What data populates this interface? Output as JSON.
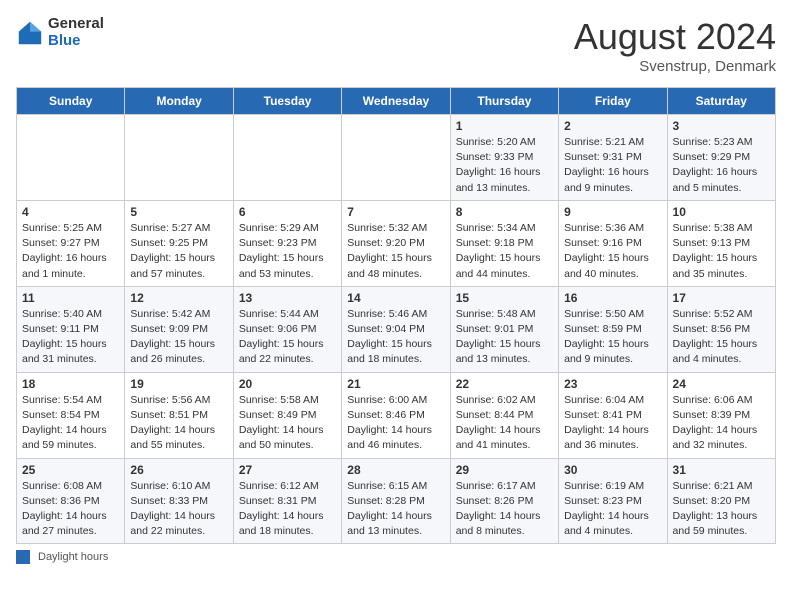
{
  "header": {
    "logo_general": "General",
    "logo_blue": "Blue",
    "title": "August 2024",
    "location": "Svenstrup, Denmark"
  },
  "days_of_week": [
    "Sunday",
    "Monday",
    "Tuesday",
    "Wednesday",
    "Thursday",
    "Friday",
    "Saturday"
  ],
  "weeks": [
    [
      {
        "day": "",
        "detail": ""
      },
      {
        "day": "",
        "detail": ""
      },
      {
        "day": "",
        "detail": ""
      },
      {
        "day": "",
        "detail": ""
      },
      {
        "day": "1",
        "detail": "Sunrise: 5:20 AM\nSunset: 9:33 PM\nDaylight: 16 hours\nand 13 minutes."
      },
      {
        "day": "2",
        "detail": "Sunrise: 5:21 AM\nSunset: 9:31 PM\nDaylight: 16 hours\nand 9 minutes."
      },
      {
        "day": "3",
        "detail": "Sunrise: 5:23 AM\nSunset: 9:29 PM\nDaylight: 16 hours\nand 5 minutes."
      }
    ],
    [
      {
        "day": "4",
        "detail": "Sunrise: 5:25 AM\nSunset: 9:27 PM\nDaylight: 16 hours\nand 1 minute."
      },
      {
        "day": "5",
        "detail": "Sunrise: 5:27 AM\nSunset: 9:25 PM\nDaylight: 15 hours\nand 57 minutes."
      },
      {
        "day": "6",
        "detail": "Sunrise: 5:29 AM\nSunset: 9:23 PM\nDaylight: 15 hours\nand 53 minutes."
      },
      {
        "day": "7",
        "detail": "Sunrise: 5:32 AM\nSunset: 9:20 PM\nDaylight: 15 hours\nand 48 minutes."
      },
      {
        "day": "8",
        "detail": "Sunrise: 5:34 AM\nSunset: 9:18 PM\nDaylight: 15 hours\nand 44 minutes."
      },
      {
        "day": "9",
        "detail": "Sunrise: 5:36 AM\nSunset: 9:16 PM\nDaylight: 15 hours\nand 40 minutes."
      },
      {
        "day": "10",
        "detail": "Sunrise: 5:38 AM\nSunset: 9:13 PM\nDaylight: 15 hours\nand 35 minutes."
      }
    ],
    [
      {
        "day": "11",
        "detail": "Sunrise: 5:40 AM\nSunset: 9:11 PM\nDaylight: 15 hours\nand 31 minutes."
      },
      {
        "day": "12",
        "detail": "Sunrise: 5:42 AM\nSunset: 9:09 PM\nDaylight: 15 hours\nand 26 minutes."
      },
      {
        "day": "13",
        "detail": "Sunrise: 5:44 AM\nSunset: 9:06 PM\nDaylight: 15 hours\nand 22 minutes."
      },
      {
        "day": "14",
        "detail": "Sunrise: 5:46 AM\nSunset: 9:04 PM\nDaylight: 15 hours\nand 18 minutes."
      },
      {
        "day": "15",
        "detail": "Sunrise: 5:48 AM\nSunset: 9:01 PM\nDaylight: 15 hours\nand 13 minutes."
      },
      {
        "day": "16",
        "detail": "Sunrise: 5:50 AM\nSunset: 8:59 PM\nDaylight: 15 hours\nand 9 minutes."
      },
      {
        "day": "17",
        "detail": "Sunrise: 5:52 AM\nSunset: 8:56 PM\nDaylight: 15 hours\nand 4 minutes."
      }
    ],
    [
      {
        "day": "18",
        "detail": "Sunrise: 5:54 AM\nSunset: 8:54 PM\nDaylight: 14 hours\nand 59 minutes."
      },
      {
        "day": "19",
        "detail": "Sunrise: 5:56 AM\nSunset: 8:51 PM\nDaylight: 14 hours\nand 55 minutes."
      },
      {
        "day": "20",
        "detail": "Sunrise: 5:58 AM\nSunset: 8:49 PM\nDaylight: 14 hours\nand 50 minutes."
      },
      {
        "day": "21",
        "detail": "Sunrise: 6:00 AM\nSunset: 8:46 PM\nDaylight: 14 hours\nand 46 minutes."
      },
      {
        "day": "22",
        "detail": "Sunrise: 6:02 AM\nSunset: 8:44 PM\nDaylight: 14 hours\nand 41 minutes."
      },
      {
        "day": "23",
        "detail": "Sunrise: 6:04 AM\nSunset: 8:41 PM\nDaylight: 14 hours\nand 36 minutes."
      },
      {
        "day": "24",
        "detail": "Sunrise: 6:06 AM\nSunset: 8:39 PM\nDaylight: 14 hours\nand 32 minutes."
      }
    ],
    [
      {
        "day": "25",
        "detail": "Sunrise: 6:08 AM\nSunset: 8:36 PM\nDaylight: 14 hours\nand 27 minutes."
      },
      {
        "day": "26",
        "detail": "Sunrise: 6:10 AM\nSunset: 8:33 PM\nDaylight: 14 hours\nand 22 minutes."
      },
      {
        "day": "27",
        "detail": "Sunrise: 6:12 AM\nSunset: 8:31 PM\nDaylight: 14 hours\nand 18 minutes."
      },
      {
        "day": "28",
        "detail": "Sunrise: 6:15 AM\nSunset: 8:28 PM\nDaylight: 14 hours\nand 13 minutes."
      },
      {
        "day": "29",
        "detail": "Sunrise: 6:17 AM\nSunset: 8:26 PM\nDaylight: 14 hours\nand 8 minutes."
      },
      {
        "day": "30",
        "detail": "Sunrise: 6:19 AM\nSunset: 8:23 PM\nDaylight: 14 hours\nand 4 minutes."
      },
      {
        "day": "31",
        "detail": "Sunrise: 6:21 AM\nSunset: 8:20 PM\nDaylight: 13 hours\nand 59 minutes."
      }
    ]
  ],
  "legend": {
    "box_label": "Daylight hours"
  }
}
